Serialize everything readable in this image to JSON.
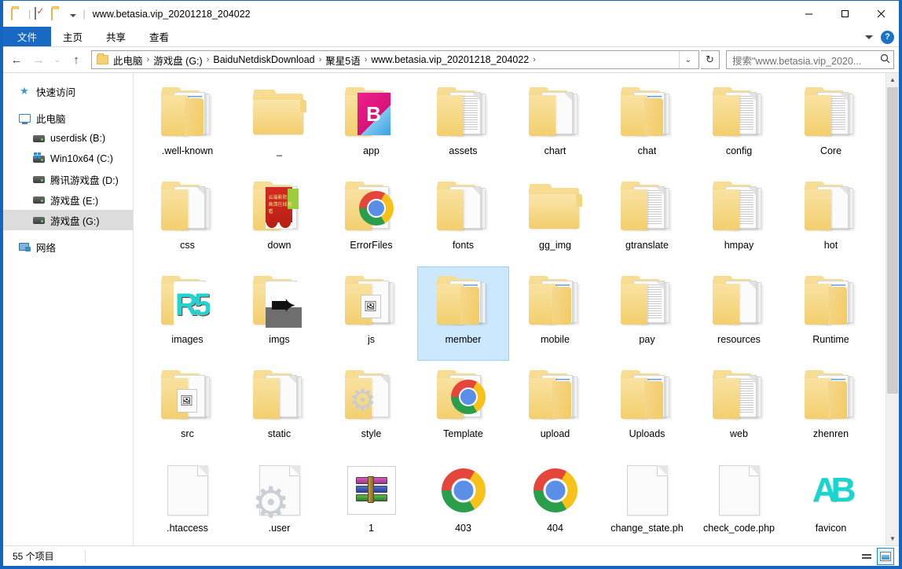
{
  "window": {
    "title": "www.betasia.vip_20201218_204022",
    "quick_access": [
      "folder-icon",
      "properties-icon",
      "new-folder-icon",
      "customize-caret"
    ],
    "controls": {
      "minimize": "–",
      "maximize": "□",
      "close": "✕"
    }
  },
  "ribbon": {
    "tabs": [
      {
        "label": "文件",
        "active_blue": true
      },
      {
        "label": "主页",
        "active_blue": false
      },
      {
        "label": "共享",
        "active_blue": false
      },
      {
        "label": "查看",
        "active_blue": false
      }
    ],
    "expand_icon": "chevron-down-icon",
    "help_label": "?"
  },
  "address": {
    "back": "←",
    "forward": "→",
    "recent": "⌄",
    "up": "↑",
    "breadcrumbs": [
      "此电脑",
      "游戏盘 (G:)",
      "BaiduNetdiskDownload",
      "聚星5语",
      "www.betasia.vip_20201218_204022"
    ],
    "dropdown_caret": "⌄",
    "refresh": "↻",
    "search_placeholder": "搜索\"www.betasia.vip_2020...",
    "search_icon": "search-icon"
  },
  "sidebar": {
    "items": [
      {
        "label": "快速访问",
        "icon": "star-icon",
        "indent": false,
        "selected": false,
        "gap_after": true
      },
      {
        "label": "此电脑",
        "icon": "computer-icon",
        "indent": false,
        "selected": false,
        "gap_after": false
      },
      {
        "label": "userdisk (B:)",
        "icon": "drive-icon",
        "indent": true,
        "selected": false,
        "gap_after": false
      },
      {
        "label": "Win10x64 (C:)",
        "icon": "windows-drive-icon",
        "indent": true,
        "selected": false,
        "gap_after": false
      },
      {
        "label": "腾讯游戏盘 (D:)",
        "icon": "drive-icon",
        "indent": true,
        "selected": false,
        "gap_after": false
      },
      {
        "label": "游戏盘 (E:)",
        "icon": "drive-icon",
        "indent": true,
        "selected": false,
        "gap_after": false
      },
      {
        "label": "游戏盘 (G:)",
        "icon": "drive-icon",
        "indent": true,
        "selected": true,
        "gap_after": true
      },
      {
        "label": "网络",
        "icon": "network-icon",
        "indent": false,
        "selected": false,
        "gap_after": false
      }
    ]
  },
  "files": {
    "items": [
      {
        "name": ".well-known",
        "kind": "folder",
        "art": "photo",
        "selected": false
      },
      {
        "name": "_",
        "kind": "folder",
        "art": "plain",
        "selected": false
      },
      {
        "name": "app",
        "kind": "folder",
        "art": "app-logo",
        "selected": false
      },
      {
        "name": "assets",
        "kind": "folder",
        "art": "lines",
        "selected": false
      },
      {
        "name": "chart",
        "kind": "folder",
        "art": "blank",
        "selected": false
      },
      {
        "name": "chat",
        "kind": "folder",
        "art": "photo",
        "selected": false
      },
      {
        "name": "config",
        "kind": "folder",
        "art": "lines",
        "selected": false
      },
      {
        "name": "Core",
        "kind": "folder",
        "art": "lines",
        "selected": false
      },
      {
        "name": "css",
        "kind": "folder",
        "art": "blank",
        "selected": false
      },
      {
        "name": "down",
        "kind": "folder",
        "art": "banner",
        "selected": false
      },
      {
        "name": "ErrorFiles",
        "kind": "folder",
        "art": "chrome",
        "selected": false
      },
      {
        "name": "fonts",
        "kind": "folder",
        "art": "blank",
        "selected": false
      },
      {
        "name": "gg_img",
        "kind": "folder",
        "art": "plain",
        "selected": false
      },
      {
        "name": "gtranslate",
        "kind": "folder",
        "art": "lines",
        "selected": false
      },
      {
        "name": "hmpay",
        "kind": "folder",
        "art": "lines",
        "selected": false
      },
      {
        "name": "hot",
        "kind": "folder",
        "art": "blank",
        "selected": false
      },
      {
        "name": "images",
        "kind": "folder",
        "art": "teal-art",
        "selected": false
      },
      {
        "name": "imgs",
        "kind": "folder",
        "art": "arrow-art",
        "selected": false
      },
      {
        "name": "js",
        "kind": "folder",
        "art": "pic",
        "selected": false
      },
      {
        "name": "member",
        "kind": "folder",
        "art": "photo",
        "selected": true
      },
      {
        "name": "mobile",
        "kind": "folder",
        "art": "photo",
        "selected": false
      },
      {
        "name": "pay",
        "kind": "folder",
        "art": "lines",
        "selected": false
      },
      {
        "name": "resources",
        "kind": "folder",
        "art": "blank",
        "selected": false
      },
      {
        "name": "Runtime",
        "kind": "folder",
        "art": "photo",
        "selected": false
      },
      {
        "name": "src",
        "kind": "folder",
        "art": "pic",
        "selected": false
      },
      {
        "name": "static",
        "kind": "folder",
        "art": "blank",
        "selected": false
      },
      {
        "name": "style",
        "kind": "folder",
        "art": "gear",
        "selected": false
      },
      {
        "name": "Template",
        "kind": "folder",
        "art": "chrome",
        "selected": false
      },
      {
        "name": "upload",
        "kind": "folder",
        "art": "photo",
        "selected": false
      },
      {
        "name": "Uploads",
        "kind": "folder",
        "art": "photo",
        "selected": false
      },
      {
        "name": "web",
        "kind": "folder",
        "art": "lines",
        "selected": false
      },
      {
        "name": "zhenren",
        "kind": "folder",
        "art": "photo",
        "selected": false
      },
      {
        "name": ".htaccess",
        "kind": "file",
        "art": "doc",
        "selected": false
      },
      {
        "name": ".user",
        "kind": "file",
        "art": "doc-gear",
        "selected": false
      },
      {
        "name": "1",
        "kind": "file",
        "art": "rar",
        "selected": false
      },
      {
        "name": "403",
        "kind": "file",
        "art": "chrome-file",
        "selected": false
      },
      {
        "name": "404",
        "kind": "file",
        "art": "chrome-file",
        "selected": false
      },
      {
        "name": "change_state.ph",
        "kind": "file",
        "art": "doc",
        "selected": false
      },
      {
        "name": "check_code.php",
        "kind": "file",
        "art": "doc",
        "selected": false
      },
      {
        "name": "favicon",
        "kind": "file",
        "art": "favicon-art",
        "selected": false
      }
    ]
  },
  "statusbar": {
    "count_text": "55 个项目",
    "views": [
      {
        "name": "details-view",
        "active": false
      },
      {
        "name": "large-icons-view",
        "active": true
      }
    ]
  },
  "colors": {
    "window_border": "#1565c0",
    "file_tab": "#1769c4",
    "selection": "#cce8ff",
    "sidebar_selection": "#dcdcdc",
    "folder_yellow": "#f3cf72"
  }
}
